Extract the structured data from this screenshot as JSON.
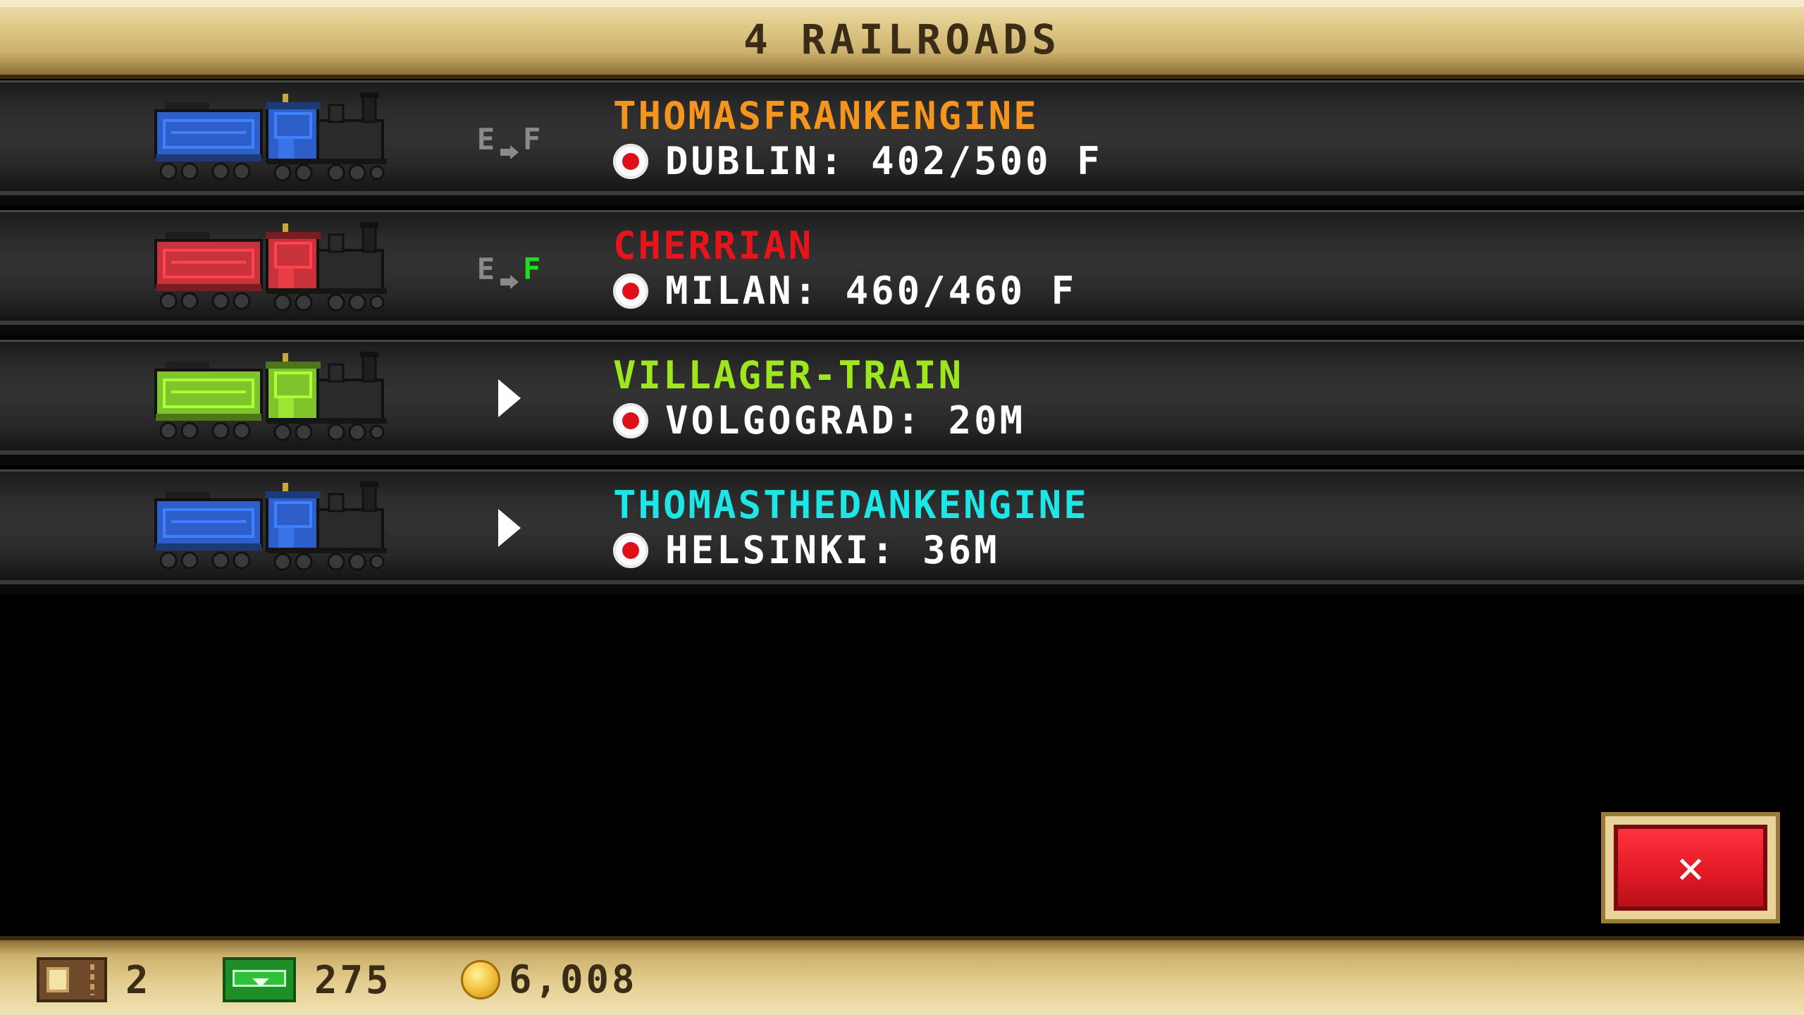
{
  "header": {
    "title": "4 RAILROADS"
  },
  "trains": [
    {
      "name": "THOMASFRANKENGINE",
      "name_color": "#f5951e",
      "train_color": "#2e5fc8",
      "status": "load",
      "status_empty": "E",
      "status_full": "F",
      "status_full_active": false,
      "destination": "DUBLIN: 402/500 F"
    },
    {
      "name": "CHERRIAN",
      "name_color": "#e8141c",
      "train_color": "#c8323a",
      "status": "load",
      "status_empty": "E",
      "status_full": "F",
      "status_full_active": true,
      "destination": "MILAN: 460/460 F"
    },
    {
      "name": "VILLAGER-TRAIN",
      "name_color": "#9ee61e",
      "train_color": "#7fc42a",
      "status": "play",
      "status_icon": "play-icon",
      "destination": "VOLGOGRAD: 20M"
    },
    {
      "name": "THOMASTHEDANKENGINE",
      "name_color": "#1ee6e6",
      "train_color": "#2e5fc8",
      "status": "play",
      "status_icon": "play-icon",
      "destination": "HELSINKI: 36M"
    }
  ],
  "close_button": {
    "label": "✕",
    "icon": "close-icon"
  },
  "footer": {
    "tickets": {
      "icon": "ticket-icon",
      "value": "2"
    },
    "cash": {
      "icon": "cash-icon",
      "value": "275"
    },
    "coins": {
      "icon": "coin-icon",
      "value": "6,008"
    }
  }
}
